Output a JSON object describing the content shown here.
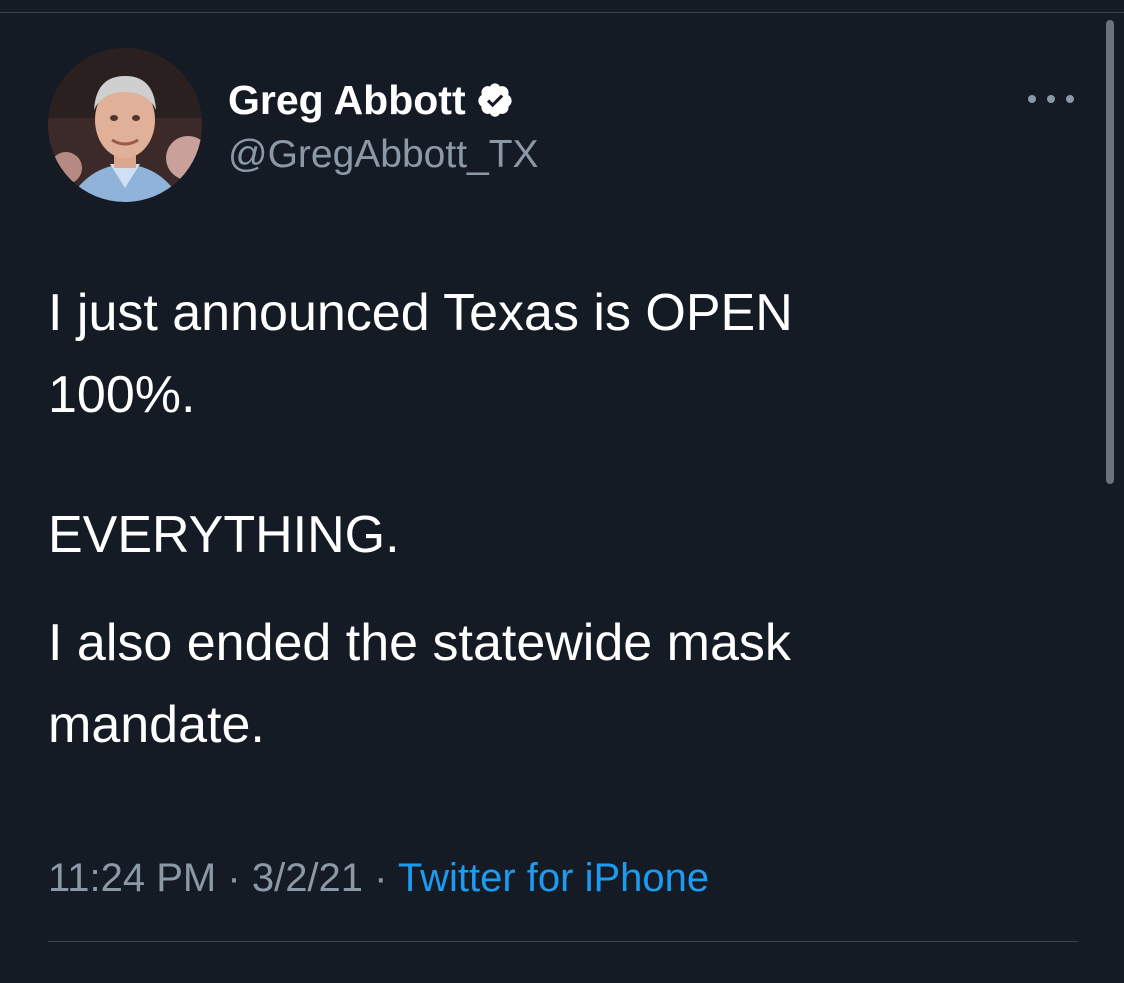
{
  "user": {
    "display_name": "Greg Abbott",
    "handle": "@GregAbbott_TX",
    "verified_icon": "verified-badge-icon",
    "avatar_icon": "profile-photo"
  },
  "tweet": {
    "paragraphs": [
      "I just announced Texas is OPEN\n100%.",
      "EVERYTHING.",
      "I also ended the statewide mask\nmandate."
    ],
    "time": "11:24 PM",
    "separator": "·",
    "date": "3/2/21",
    "source": "Twitter for iPhone"
  },
  "colors": {
    "background": "#151b25",
    "text": "#ffffff",
    "secondary": "#8b98a5",
    "link": "#1d9bf0"
  },
  "icons": {
    "more": "more-options-icon"
  }
}
